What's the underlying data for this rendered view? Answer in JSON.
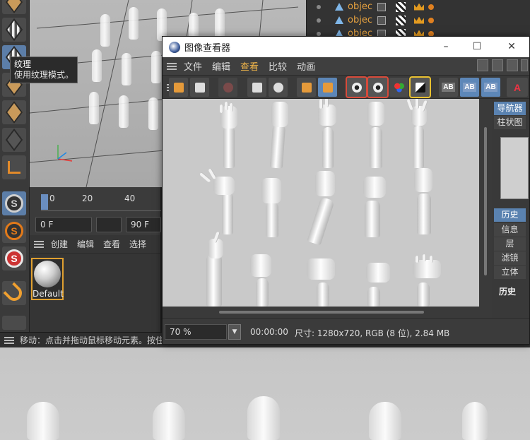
{
  "tooltip": {
    "title": "纹理",
    "description": "使用纹理模式。"
  },
  "objects": {
    "rows": [
      {
        "name": "objec"
      },
      {
        "name": "objec"
      },
      {
        "name": "objec"
      }
    ]
  },
  "timeline": {
    "ticks": [
      "0",
      "20",
      "40"
    ],
    "start_frame": "0 F",
    "end_frame": "90 F"
  },
  "materials": {
    "menu": [
      "创建",
      "编辑",
      "查看",
      "选择"
    ],
    "material_name": "Default"
  },
  "status": {
    "text": "移动：点击并拖动鼠标移动元素。按住 SHIFT 键量化移动；节点编辑模式时按"
  },
  "viewer": {
    "title": "图像查看器",
    "menu": [
      {
        "label": "文件",
        "active": false
      },
      {
        "label": "编辑",
        "active": false
      },
      {
        "label": "查看",
        "active": true
      },
      {
        "label": "比较",
        "active": false
      },
      {
        "label": "动画",
        "active": false
      }
    ],
    "side_tabs_top": [
      "导航器",
      "柱状图"
    ],
    "side_tabs_bottom": [
      "历史",
      "信息",
      "层",
      "滤镜",
      "立体"
    ],
    "side_heading": "历史",
    "zoom": "70 %",
    "timecode": "00:00:00",
    "size_info": "尺寸: 1280x720, RGB (8 位), 2.84 MB",
    "toolbar_ab_labels": [
      "AB",
      "AB",
      "AB"
    ],
    "toolbar_a_label": "A"
  },
  "colors": {
    "accent": "#e7a23f",
    "highlight": "#5d87b8",
    "menu_active": "#f0b54a"
  }
}
